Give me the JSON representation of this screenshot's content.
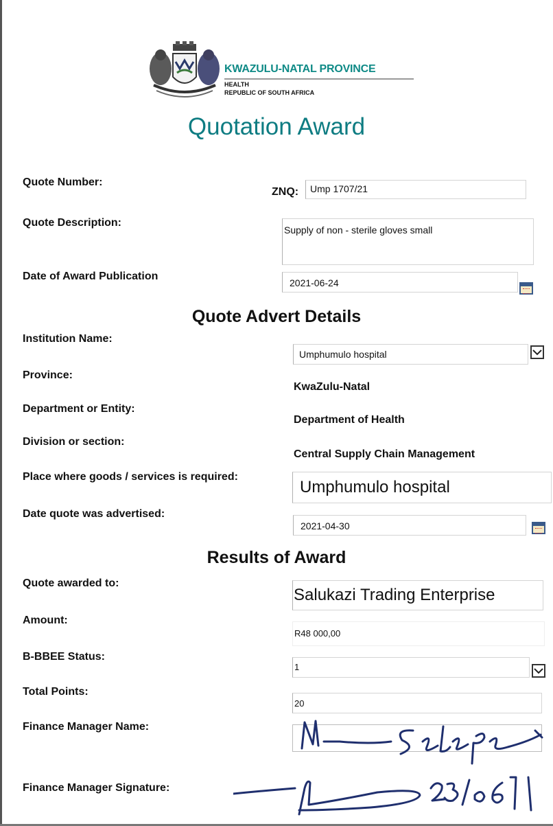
{
  "header": {
    "province": "KWAZULU-NATAL PROVINCE",
    "department": "HEALTH",
    "country": "REPUBLIC OF SOUTH AFRICA",
    "title": "Quotation Award"
  },
  "quote": {
    "number_label": "Quote Number:",
    "number_prefix": "ZNQ:",
    "number_value": "Ump 1707/21",
    "description_label": "Quote Description:",
    "description_value": "Supply of non - sterile gloves small",
    "award_date_label": "Date of Award Publication",
    "award_date_value": "2021-06-24"
  },
  "advert": {
    "heading": "Quote Advert Details",
    "institution_label": "Institution Name:",
    "institution_value": "Umphumulo hospital",
    "province_label": "Province:",
    "province_value": "KwaZulu-Natal",
    "department_label": "Department or Entity:",
    "department_value": "Department of Health",
    "division_label": "Division or section:",
    "division_value": "Central Supply Chain Management",
    "place_label": "Place where goods /  services is required:",
    "place_value": "Umphumulo hospital",
    "advertised_label": "Date quote was advertised:",
    "advertised_value": "2021-04-30"
  },
  "results": {
    "heading": "Results of Award",
    "awarded_label": "Quote awarded to:",
    "awarded_value": "Salukazi Trading Enterprise",
    "amount_label": "Amount:",
    "amount_value": "R48 000,00",
    "bbbee_label": "B-BBEE Status:",
    "bbbee_value": "1",
    "points_label": "Total Points:",
    "points_value": "20",
    "fm_name_label": "Finance Manager Name:",
    "fm_name_handwritten": "M Selepe",
    "fm_signature_label": "Finance Manager Signature:",
    "fm_signature_date_handwritten": "23/06"
  },
  "icons": {
    "calendar": "calendar-icon",
    "dropdown": "chevron-down-icon",
    "crest": "coat-of-arms-logo"
  },
  "colors": {
    "brand_teal": "#0e8a86",
    "title_teal": "#0e7c82",
    "ink": "#1f2f6e"
  }
}
